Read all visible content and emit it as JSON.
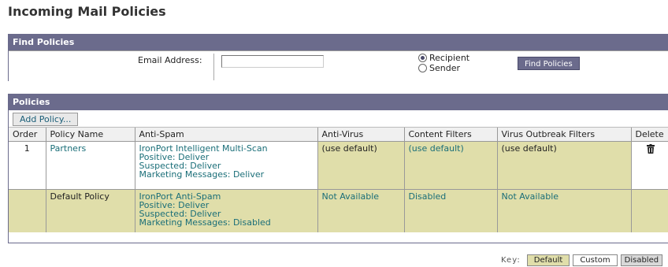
{
  "page": {
    "title": "Incoming Mail Policies"
  },
  "find_policies": {
    "header": "Find Policies",
    "email_label": "Email Address:",
    "email_value": "",
    "recipient_label": "Recipient",
    "sender_label": "Sender",
    "selected": "Recipient",
    "button_label": "Find Policies"
  },
  "policies": {
    "header": "Policies",
    "add_button": "Add Policy...",
    "columns": [
      "Order",
      "Policy Name",
      "Anti-Spam",
      "Anti-Virus",
      "Content Filters",
      "Virus Outbreak Filters",
      "Delete"
    ],
    "rows": [
      {
        "order": "1",
        "name": "Partners",
        "antispam": [
          "IronPort Intelligent Multi-Scan",
          "Positive: Deliver",
          "Suspected: Deliver",
          "Marketing Messages: Deliver"
        ],
        "antivirus": "(use default)",
        "content_filters": "(use default)",
        "outbreak_filters": "(use default)",
        "delete_icon": "trash-icon"
      },
      {
        "order": "",
        "name": "Default Policy",
        "antispam": [
          "IronPort Anti-Spam",
          "Positive: Deliver",
          "Suspected: Deliver",
          "Marketing Messages: Disabled"
        ],
        "antivirus": "Not Available",
        "content_filters": "Disabled",
        "outbreak_filters": "Not Available"
      }
    ]
  },
  "key": {
    "label": "Key:",
    "default": "Default",
    "custom": "Custom",
    "disabled": "Disabled"
  },
  "colors": {
    "header_bg": "#6b6b8c",
    "default_bg": "#e0deaa",
    "link": "#1a6e78"
  }
}
